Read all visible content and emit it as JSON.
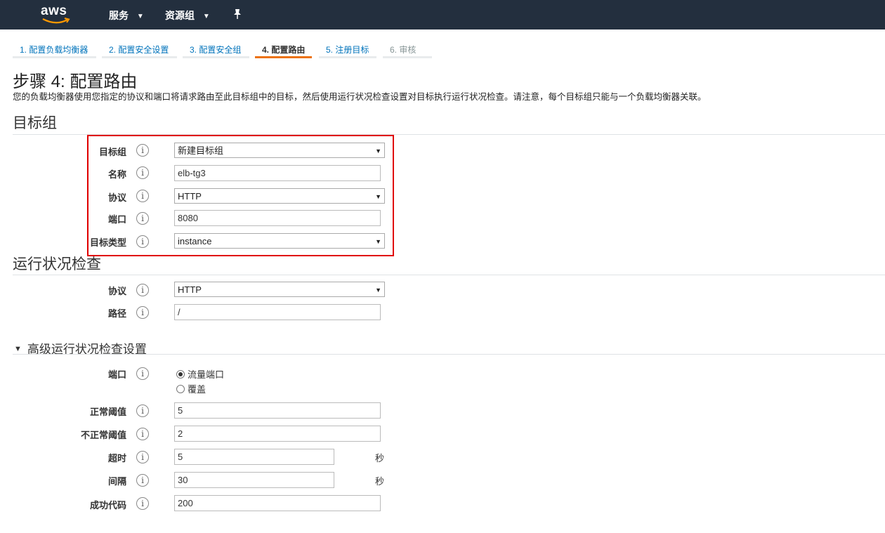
{
  "topnav": {
    "logo_text": "aws",
    "services_label": "服务",
    "resource_groups_label": "资源组",
    "caret": "⌄",
    "pin_glyph": "📌"
  },
  "tabs": [
    {
      "label": "1. 配置负载均衡器",
      "state": "link"
    },
    {
      "label": "2. 配置安全设置",
      "state": "link"
    },
    {
      "label": "3. 配置安全组",
      "state": "link"
    },
    {
      "label": "4. 配置路由",
      "state": "active"
    },
    {
      "label": "5. 注册目标",
      "state": "link"
    },
    {
      "label": "6. 审核",
      "state": "disabled"
    }
  ],
  "page": {
    "title": "步骤 4: 配置路由",
    "description": "您的负载均衡器使用您指定的协议和端口将请求路由至此目标组中的目标，然后使用运行状况检查设置对目标执行运行状况检查。请注意，每个目标组只能与一个负载均衡器关联。"
  },
  "info_glyph": "i",
  "target_group": {
    "section_title": "目标组",
    "target_group_label": "目标组",
    "target_group_value": "新建目标组",
    "name_label": "名称",
    "name_value": "elb-tg3",
    "protocol_label": "协议",
    "protocol_value": "HTTP",
    "port_label": "端口",
    "port_value": "8080",
    "target_type_label": "目标类型",
    "target_type_value": "instance"
  },
  "health_check": {
    "section_title": "运行状况检查",
    "protocol_label": "协议",
    "protocol_value": "HTTP",
    "path_label": "路径",
    "path_value": "/"
  },
  "advanced": {
    "section_title": "高级运行状况检查设置",
    "toggle_glyph": "▼",
    "port_label": "端口",
    "radio_traffic_port": "流量端口",
    "radio_override": "覆盖",
    "selected_port_option": "流量端口",
    "healthy_threshold_label": "正常阈值",
    "healthy_threshold_value": "5",
    "unhealthy_threshold_label": "不正常阈值",
    "unhealthy_threshold_value": "2",
    "timeout_label": "超时",
    "timeout_value": "5",
    "timeout_unit": "秒",
    "interval_label": "间隔",
    "interval_value": "30",
    "interval_unit": "秒",
    "success_codes_label": "成功代码",
    "success_codes_value": "200"
  },
  "colors": {
    "nav_bg": "#232f3e",
    "link": "#0073bb",
    "active_tab_underline": "#ec7211",
    "highlight_box": "#e00000",
    "logo_smile": "#ff9900"
  }
}
